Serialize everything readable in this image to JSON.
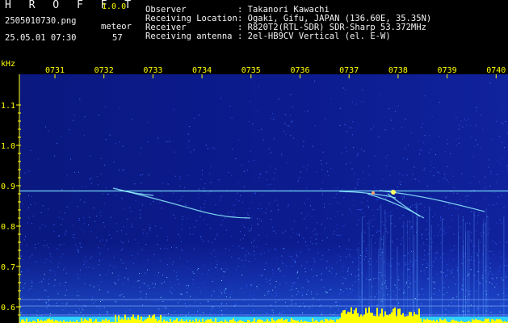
{
  "header": {
    "app_name": "H R O F F T",
    "app_version": "1.0.0",
    "filename": "2505010730.png",
    "datetime": "25.05.01 07:30",
    "meteor_label": "meteor",
    "meteor_count": "57"
  },
  "info": [
    {
      "label": "Observer",
      "value": ": Takanori Kawachi"
    },
    {
      "label": "Receiving Location",
      "value": ": Ogaki, Gifu, JAPAN (136.60E, 35.35N)"
    },
    {
      "label": "Receiver",
      "value": ": R820T2(RTL-SDR) SDR-Sharp 53.372MHz"
    },
    {
      "label": "Receiving antenna",
      "value": ": 2el-HB9CV Vertical (el. E-W)"
    }
  ],
  "chart_data": {
    "type": "heatmap",
    "ylabel": "kHz",
    "y_ticks": [
      "1.1",
      "1.0",
      "0.9",
      "0.8",
      "0.7",
      "0.6"
    ],
    "y_values": [
      1.1,
      1.0,
      0.9,
      0.8,
      0.7,
      0.6
    ],
    "x_ticks": [
      "0731",
      "0732",
      "0733",
      "0734",
      "0735",
      "0736",
      "0737",
      "0738",
      "0739",
      "0740"
    ],
    "carrier_khz": 0.887,
    "colors": {
      "background": "#0a1890",
      "noise": "#3a6cff",
      "trace": "#8ff0ff",
      "header_label": "#9ef0a6",
      "accent": "#ffff00"
    }
  }
}
